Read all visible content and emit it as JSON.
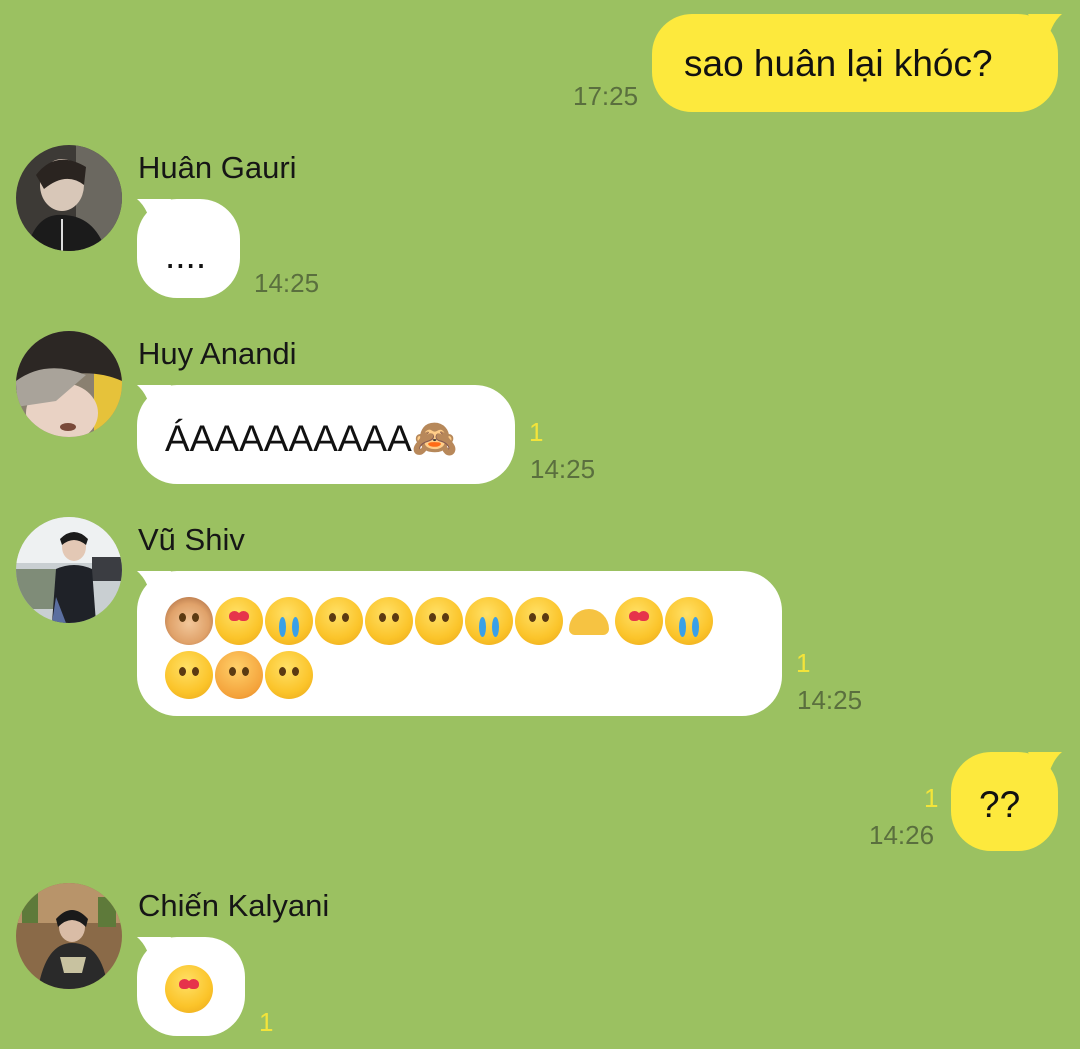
{
  "messages": [
    {
      "id": "m1",
      "direction": "out",
      "text": "sao huân lại khóc?",
      "time": "17:25"
    },
    {
      "id": "m2",
      "direction": "in",
      "sender": "Huân Gauri",
      "text": "....",
      "time": "14:25"
    },
    {
      "id": "m3",
      "direction": "in",
      "sender": "Huy Anandi",
      "text": "ÁAAAAAAAAA🙈",
      "unread": "1",
      "time": "14:25"
    },
    {
      "id": "m4",
      "direction": "in",
      "sender": "Vũ Shiv",
      "emojis_row1": [
        "🙈",
        "😍",
        "😭",
        "😃",
        "😇",
        "🤨",
        "🥲",
        "😌",
        "🫶",
        "😍",
        "😢"
      ],
      "emojis_row2": [
        "🥺",
        "😠",
        "😮‍💨"
      ],
      "unread": "1",
      "time": "14:25"
    },
    {
      "id": "m5",
      "direction": "out",
      "text": "??",
      "unread": "1",
      "time": "14:26"
    },
    {
      "id": "m6",
      "direction": "in",
      "sender": "Chiến Kalyani",
      "text": "🥰",
      "unread": "1"
    }
  ],
  "colors": {
    "background": "#9bc161",
    "incoming_bubble": "#ffffff",
    "outgoing_bubble": "#fde93d",
    "unread_count": "#f3e43a",
    "timestamp": "#5a6f3e"
  }
}
